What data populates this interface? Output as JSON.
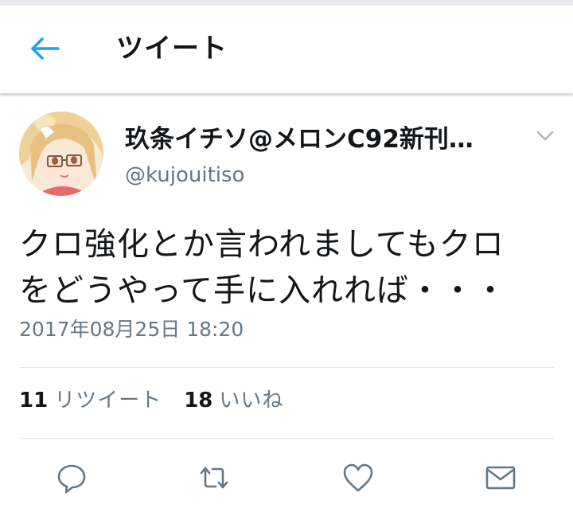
{
  "header": {
    "title": "ツイート",
    "back_icon": "back-arrow-icon",
    "accent_color": "#1da1f2"
  },
  "tweet": {
    "author": {
      "display_name": "玖条イチソ@メロンC92新刊…",
      "handle": "@kujouitiso"
    },
    "text_lines": [
      "クロ強化とか言われましてもクロ",
      "をどうやって手に入れれば・・・"
    ],
    "timestamp": "2017年08月25日 18:20",
    "stats": {
      "retweet_count": "11",
      "retweet_label": "リツイート",
      "like_count": "18",
      "like_label": "いいね"
    }
  },
  "actions": [
    {
      "name": "reply",
      "icon": "reply-icon"
    },
    {
      "name": "retweet",
      "icon": "retweet-icon"
    },
    {
      "name": "like",
      "icon": "heart-icon"
    },
    {
      "name": "direct-message",
      "icon": "envelope-icon"
    }
  ],
  "colors": {
    "text_primary": "#14171a",
    "text_secondary": "#657786",
    "divider": "#e1e8ed"
  }
}
